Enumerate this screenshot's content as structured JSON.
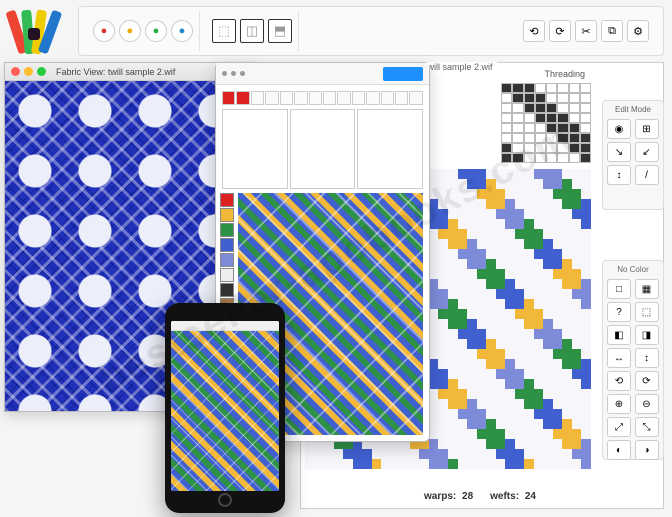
{
  "app": {
    "fabric_window_title": "Fabric View: twill sample 2.wif",
    "draft_window_title": "twill sample 2.wif"
  },
  "toolbar": {
    "group_colors": [
      "#d33",
      "#ea0",
      "#2a4",
      "#28c"
    ],
    "big_buttons": [
      {
        "icon": "⬚",
        "label": ""
      },
      {
        "icon": "◫",
        "label": ""
      },
      {
        "icon": "⬒",
        "label": ""
      }
    ],
    "util_icons": [
      "⟲",
      "⟳",
      "✂",
      "⧉",
      "⚙"
    ]
  },
  "side_panels": {
    "edit_mode_title": "Edit Mode",
    "edit_mode_buttons": [
      "◉",
      "⊞",
      "↘",
      "↙",
      "↕",
      "/"
    ],
    "no_color_title": "No Color",
    "tool_buttons": [
      "□",
      "▦",
      "?",
      "⬚",
      "◧",
      "◨",
      "↔",
      "↕",
      "⟲",
      "⟳",
      "⊕",
      "⊖",
      "⤢",
      "⤡",
      "◐",
      "◑"
    ]
  },
  "draft": {
    "threading_label": "Threading",
    "tieup_size": 8,
    "treadling_len": 24,
    "footer": {
      "warps_label": "warps:",
      "warps_value": "28",
      "wefts_label": "wefts:",
      "wefts_value": "24"
    }
  },
  "editor": {
    "ruler_count": 14,
    "palette": [
      "#d22",
      "#f2b83a",
      "#2d9146",
      "#4060d0",
      "#7e8bd9",
      "#eee",
      "#333",
      "#b07e4a",
      "#7bc",
      "#c7b"
    ]
  },
  "watermark_text": "bestseller-apobooks.com"
}
